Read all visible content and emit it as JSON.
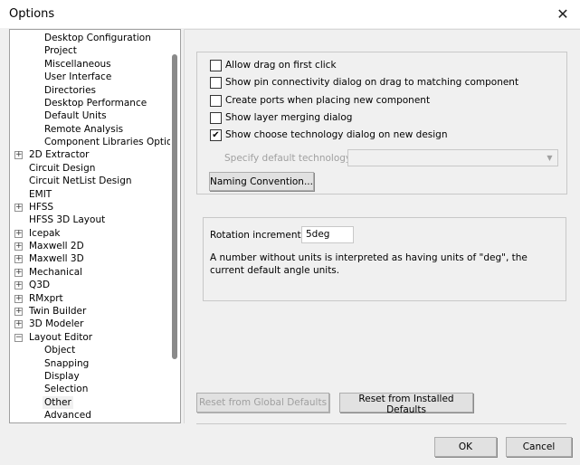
{
  "window": {
    "title": "Options",
    "close_icon": "close-icon"
  },
  "tree": {
    "items": [
      {
        "label": "Desktop Configuration",
        "level": 1
      },
      {
        "label": "Project",
        "level": 1
      },
      {
        "label": "Miscellaneous",
        "level": 1
      },
      {
        "label": "User Interface",
        "level": 1
      },
      {
        "label": "Directories",
        "level": 1
      },
      {
        "label": "Desktop Performance",
        "level": 1
      },
      {
        "label": "Default Units",
        "level": 1
      },
      {
        "label": "Remote Analysis",
        "level": 1
      },
      {
        "label": "Component Libraries Options",
        "level": 1
      },
      {
        "label": "2D Extractor",
        "level": 0,
        "expander": "+"
      },
      {
        "label": "Circuit Design",
        "level": 0
      },
      {
        "label": "Circuit NetList Design",
        "level": 0
      },
      {
        "label": "EMIT",
        "level": 0
      },
      {
        "label": "HFSS",
        "level": 0,
        "expander": "+"
      },
      {
        "label": "HFSS 3D Layout",
        "level": 0
      },
      {
        "label": "Icepak",
        "level": 0,
        "expander": "+"
      },
      {
        "label": "Maxwell 2D",
        "level": 0,
        "expander": "+"
      },
      {
        "label": "Maxwell 3D",
        "level": 0,
        "expander": "+"
      },
      {
        "label": "Mechanical",
        "level": 0,
        "expander": "+"
      },
      {
        "label": "Q3D",
        "level": 0,
        "expander": "+"
      },
      {
        "label": "RMxprt",
        "level": 0,
        "expander": "+"
      },
      {
        "label": "Twin Builder",
        "level": 0,
        "expander": "+"
      },
      {
        "label": "3D Modeler",
        "level": 0,
        "expander": "+"
      },
      {
        "label": "Layout Editor",
        "level": 0,
        "expander": "−"
      },
      {
        "label": "Object",
        "level": 1
      },
      {
        "label": "Snapping",
        "level": 1
      },
      {
        "label": "Display",
        "level": 1
      },
      {
        "label": "Selection",
        "level": 1
      },
      {
        "label": "Other",
        "level": 1,
        "selected": true
      },
      {
        "label": "Advanced",
        "level": 1
      }
    ]
  },
  "options": {
    "checkboxes": [
      {
        "label": "Allow drag on first click",
        "checked": false
      },
      {
        "label": "Show pin connectivity dialog on drag to matching component",
        "checked": false
      },
      {
        "label": "Create ports when placing new component",
        "checked": false
      },
      {
        "label": "Show layer merging dialog",
        "checked": false
      },
      {
        "label": "Show choose technology dialog on new design",
        "checked": true
      }
    ],
    "default_technology_label": "Specify default technology:",
    "default_technology_value": "",
    "naming_convention_button": "Naming Convention..."
  },
  "rotation": {
    "label": "Rotation increment:",
    "value": "5deg",
    "note": "A number without units is interpreted as having units of \"deg\", the current default angle units."
  },
  "buttons": {
    "reset_global": "Reset from Global Defaults",
    "reset_installed": "Reset from Installed Defaults",
    "ok": "OK",
    "cancel": "Cancel"
  }
}
